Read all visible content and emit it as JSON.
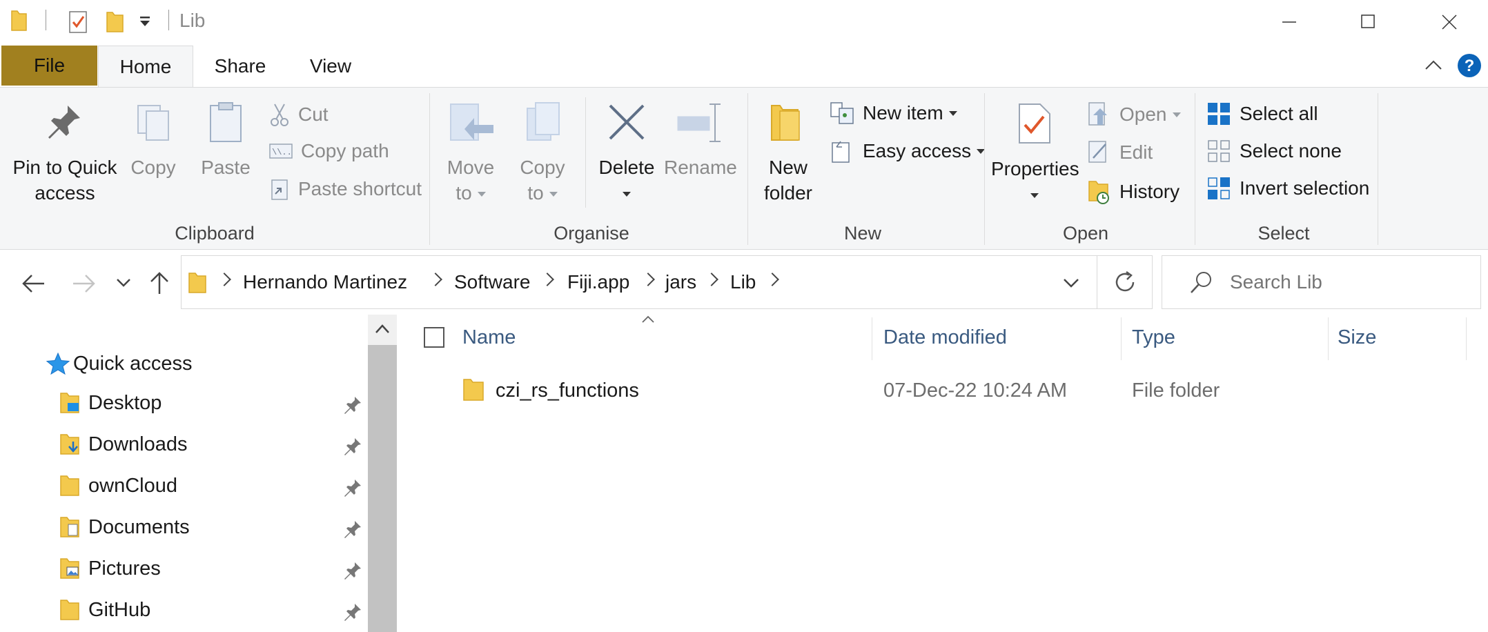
{
  "window": {
    "title": "Lib",
    "controls": {
      "minimize": "minimize",
      "maximize": "maximize",
      "close": "close"
    }
  },
  "ribbon_tabs": [
    "File",
    "Home",
    "Share",
    "View"
  ],
  "ribbon": {
    "clipboard": {
      "label": "Clipboard",
      "pin_line1": "Pin to Quick",
      "pin_line2": "access",
      "copy": "Copy",
      "paste": "Paste",
      "cut": "Cut",
      "copy_path": "Copy path",
      "paste_shortcut": "Paste shortcut"
    },
    "organise": {
      "label": "Organise",
      "move_line1": "Move",
      "move_line2": "to",
      "copy_line1": "Copy",
      "copy_line2": "to",
      "delete": "Delete",
      "rename": "Rename"
    },
    "new": {
      "label": "New",
      "new_folder_line1": "New",
      "new_folder_line2": "folder",
      "new_item": "New item",
      "easy_access": "Easy access"
    },
    "open": {
      "label": "Open",
      "properties": "Properties",
      "open": "Open",
      "edit": "Edit",
      "history": "History"
    },
    "select": {
      "label": "Select",
      "select_all": "Select all",
      "select_none": "Select none",
      "invert_selection": "Invert selection"
    }
  },
  "breadcrumb": [
    "Hernando Martinez",
    "Software",
    "Fiji.app",
    "jars",
    "Lib"
  ],
  "search": {
    "placeholder": "Search Lib"
  },
  "nav": {
    "quick_access": "Quick access",
    "items": [
      {
        "label": "Desktop",
        "icon": "desktop-folder-icon"
      },
      {
        "label": "Downloads",
        "icon": "downloads-folder-icon"
      },
      {
        "label": "ownCloud",
        "icon": "folder-icon"
      },
      {
        "label": "Documents",
        "icon": "documents-folder-icon"
      },
      {
        "label": "Pictures",
        "icon": "pictures-folder-icon"
      },
      {
        "label": "GitHub",
        "icon": "folder-icon"
      }
    ]
  },
  "columns": {
    "name": "Name",
    "date": "Date modified",
    "type": "Type",
    "size": "Size"
  },
  "files": [
    {
      "name": "czi_rs_functions",
      "date": "07-Dec-22 10:24 AM",
      "type": "File folder",
      "size": ""
    }
  ],
  "colors": {
    "file_tab": "#a1801f",
    "folder": "#f3c94d",
    "accent_blue": "#1a73c7",
    "help_blue": "#0b63b8"
  }
}
